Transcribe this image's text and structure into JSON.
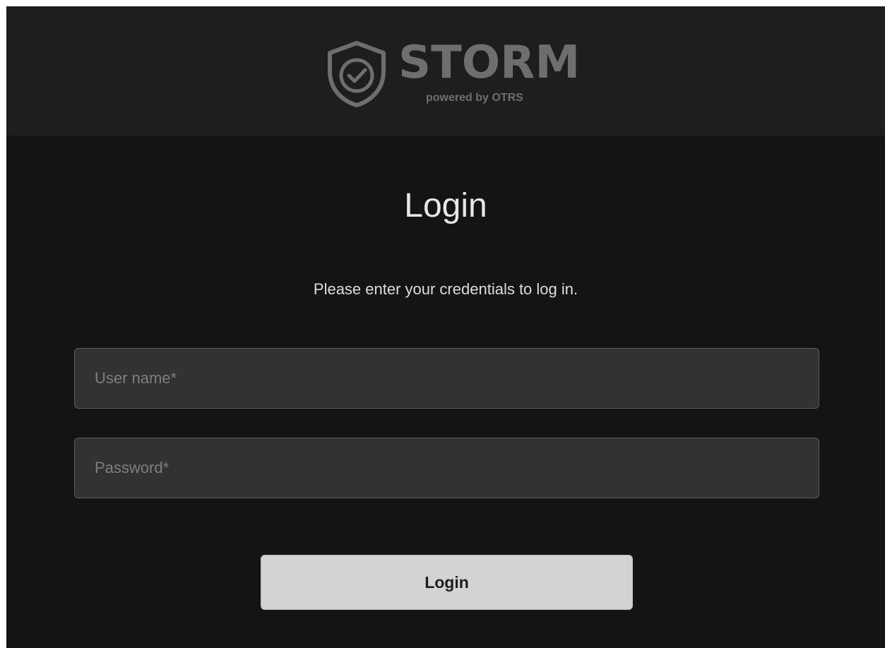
{
  "branding": {
    "name": "STORM",
    "subtitle": "powered by OTRS",
    "icon": "shield-check-icon",
    "color": "#6e6e6e"
  },
  "login": {
    "title": "Login",
    "instructions": "Please enter your credentials to log in.",
    "username_placeholder": "User name*",
    "username_value": "",
    "password_placeholder": "Password*",
    "password_value": "",
    "submit_label": "Login"
  },
  "colors": {
    "background": "#141414",
    "header_background": "#1e1e1e",
    "input_background": "#323232",
    "button_background": "#d3d3d3"
  }
}
